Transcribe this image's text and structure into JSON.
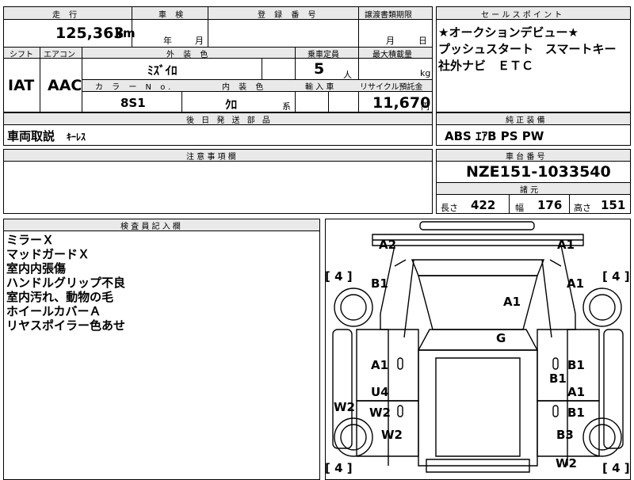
{
  "top_labels": {
    "mileage": "走 行",
    "inspection": "車 検",
    "registration": "登 録 番 号",
    "transfer_deadline": "譲渡書類期限",
    "sales_point": "セ ー ル ス ポ イ ン ト"
  },
  "mileage": {
    "value": "125,363",
    "unit": "km"
  },
  "inspection_date": {
    "year_label": "年",
    "month_label": "月"
  },
  "transfer_date": {
    "month_label": "月",
    "day_label": "日"
  },
  "second_row_labels": {
    "shift": "シフト",
    "aircon": "エアコン",
    "exterior_color": "外 装 色",
    "capacity": "乗車定員",
    "max_load": "最大積載量",
    "color_no": "カ ラ ー N o.",
    "interior_color": "内 装 色",
    "import": "輸 入 車",
    "recycle": "リサイクル預託金"
  },
  "shift": "IAT",
  "aircon": "AAC",
  "exterior_color": "ﾐｽﾞｲﾛ",
  "capacity": {
    "value": "5",
    "unit": "人"
  },
  "max_load": {
    "unit": "kg"
  },
  "color_no": "8S1",
  "interior_color": {
    "value": "ｸﾛ",
    "suffix": "系"
  },
  "recycle_fee": {
    "value": "11,670",
    "unit": "円"
  },
  "sales_points": [
    "★オークションデビュー★",
    "プッシュスタート　スマートキー",
    "社外ナビ　ＥＴＣ"
  ],
  "later_parts": {
    "header": "後 日 発 送 部 品",
    "label": "車両取説",
    "value": "ｷｰﾚｽ"
  },
  "genuine_equipment": {
    "header": "純 正 装 備",
    "value": "ABS ｴｱB PS PW"
  },
  "caution": {
    "header": "注 意 事 項 欄"
  },
  "chassis": {
    "header": "車 台 番 号",
    "value": "NZE151-1033540"
  },
  "specs": {
    "header": "諸 元",
    "length_label": "長さ",
    "length": "422",
    "width_label": "幅",
    "width": "176",
    "height_label": "高さ",
    "height": "151"
  },
  "inspector": {
    "header": "検 査 員 記 入 欄",
    "notes": [
      "ミラーＸ",
      "マッドガードＸ",
      "室内内張傷",
      "ハンドルグリップ不良",
      "室内汚れ、動物の毛",
      "ホイールカバーＡ",
      "リヤスポイラー色あせ"
    ]
  },
  "diagram_marks": {
    "front_left": "A2",
    "front_right": "A1",
    "fender_left": "B1",
    "fender_right": "A1",
    "hood": "A1",
    "roof": "G",
    "front_door_left": "A1",
    "front_door_right_a": "B1",
    "front_door_right_b": "B1",
    "rear_door_left_a": "U4",
    "rear_door_left_b": "W2",
    "rear_door_right_a": "A1",
    "rear_door_right_b": "B1",
    "side_left": "W2",
    "rear_fender_left": "W2",
    "rear_fender_right": "B3",
    "rear_right": "W2",
    "tire_fl": "4",
    "tire_fr": "4",
    "tire_rl": "4",
    "tire_rr": "4"
  }
}
